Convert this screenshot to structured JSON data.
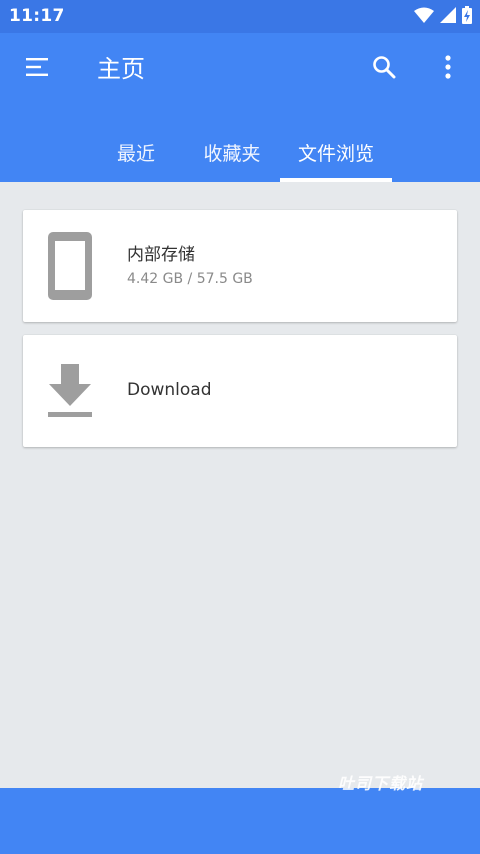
{
  "status_bar": {
    "time": "11:17",
    "icons": [
      "wifi-icon",
      "signal-icon",
      "battery-icon"
    ]
  },
  "app_bar": {
    "title": "主页",
    "menu_icon": "menu-icon",
    "search_icon": "search-icon",
    "more_icon": "more-vert-icon",
    "tabs": [
      {
        "label": "最近",
        "active": false
      },
      {
        "label": "收藏夹",
        "active": false
      },
      {
        "label": "文件浏览",
        "active": true
      }
    ]
  },
  "locations": [
    {
      "icon": "phone-icon",
      "title": "内部存储",
      "subtitle": "4.42 GB / 57.5 GB"
    },
    {
      "icon": "download-icon",
      "title": "Download"
    }
  ],
  "watermark": "吐司下载站",
  "colors": {
    "primary": "#4285f4",
    "status_bar": "#3a77e6",
    "background": "#e6e9ec",
    "icon_gray": "#9e9e9e"
  }
}
